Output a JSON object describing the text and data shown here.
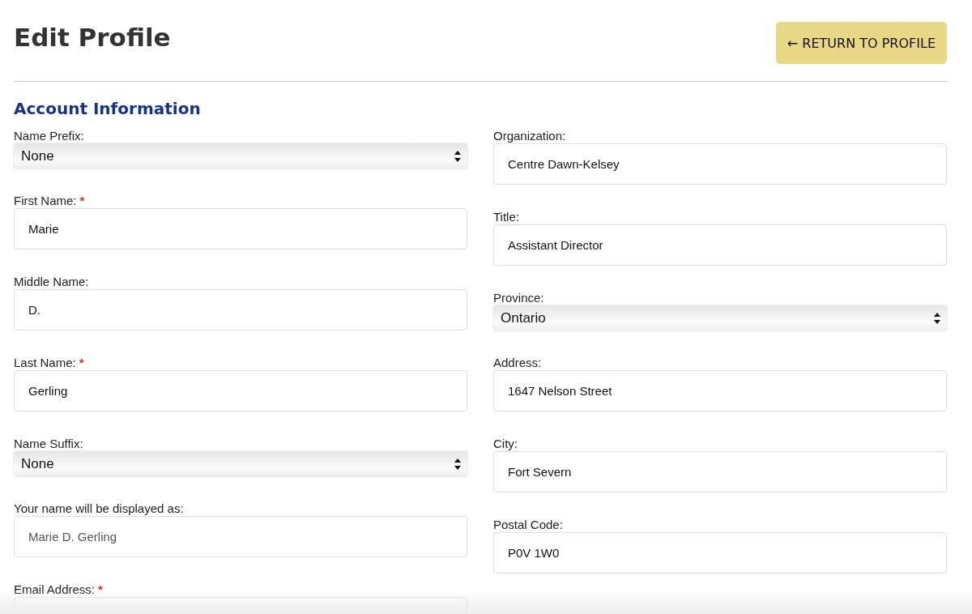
{
  "page_title": "Edit Profile",
  "return_button": {
    "label": "← RETURN TO PROFILE"
  },
  "section_title": "Account Information",
  "left_fields": [
    {
      "label": "Name Prefix:",
      "kind": "select",
      "value": "None"
    },
    {
      "label": "First Name:",
      "required_mark": "*",
      "kind": "text",
      "value": "Marie"
    },
    {
      "label": "Middle Name:",
      "kind": "text",
      "value": "D."
    },
    {
      "label": "Last Name:",
      "required_mark": "*",
      "kind": "text",
      "value": "Gerling"
    },
    {
      "label": "Name Suffix:",
      "kind": "select",
      "value": "None"
    },
    {
      "label": "Your name will be displayed as:",
      "kind": "readonly",
      "value": "Marie D. Gerling"
    },
    {
      "label": "Email Address:",
      "required_mark": "*",
      "kind": "text"
    }
  ],
  "right_fields": [
    {
      "label": "Organization:",
      "kind": "text",
      "value": "Centre Dawn-Kelsey"
    },
    {
      "label": "Title:",
      "kind": "text",
      "value": "Assistant Director"
    },
    {
      "label": "Province:",
      "kind": "select",
      "value": "Ontario"
    },
    {
      "label": "Address:",
      "kind": "text",
      "value": "1647 Nelson Street"
    },
    {
      "label": "City:",
      "kind": "text",
      "value": "Fort Severn"
    },
    {
      "label": "Postal Code:",
      "kind": "text",
      "value": "P0V 1W0"
    }
  ]
}
